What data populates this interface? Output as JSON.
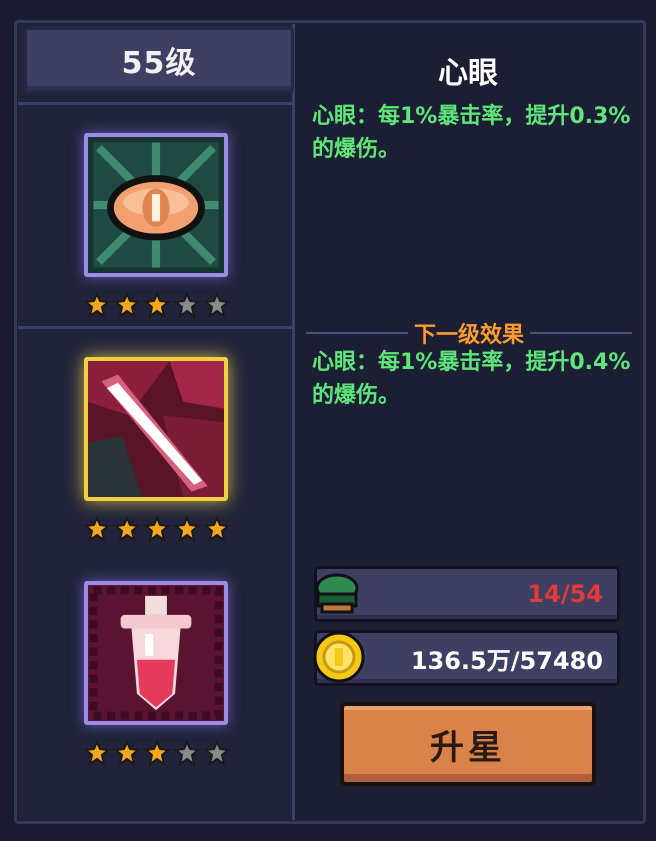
{
  "level": "55级",
  "skill": {
    "name": "心眼",
    "current_desc": "心眼：每1%暴击率，提升0.3%的爆伤。",
    "next_label": "下一级效果",
    "next_desc": "心眼：每1%暴击率，提升0.4%的爆伤。"
  },
  "slots": [
    {
      "icon": "eye-icon",
      "stars_filled": 3,
      "stars_total": 5,
      "selected": false
    },
    {
      "icon": "blade-slash-icon",
      "stars_filled": 5,
      "stars_total": 5,
      "selected": true
    },
    {
      "icon": "potion-sword-icon",
      "stars_filled": 3,
      "stars_total": 5,
      "selected": false
    }
  ],
  "resources": {
    "material": {
      "icon": "green-material-icon",
      "value": "14/54",
      "color": "#e03a3a"
    },
    "gold": {
      "icon": "gold-coin-icon",
      "value": "136.5万/57480",
      "color": "#ffffff"
    }
  },
  "upgrade_button": "升星",
  "colors": {
    "desc_green": "#5fe67a",
    "next_orange": "#ff9c2e",
    "star_gold": "#f6a51c",
    "star_gray": "#8a8a8a",
    "button_orange": "#d9824a"
  }
}
